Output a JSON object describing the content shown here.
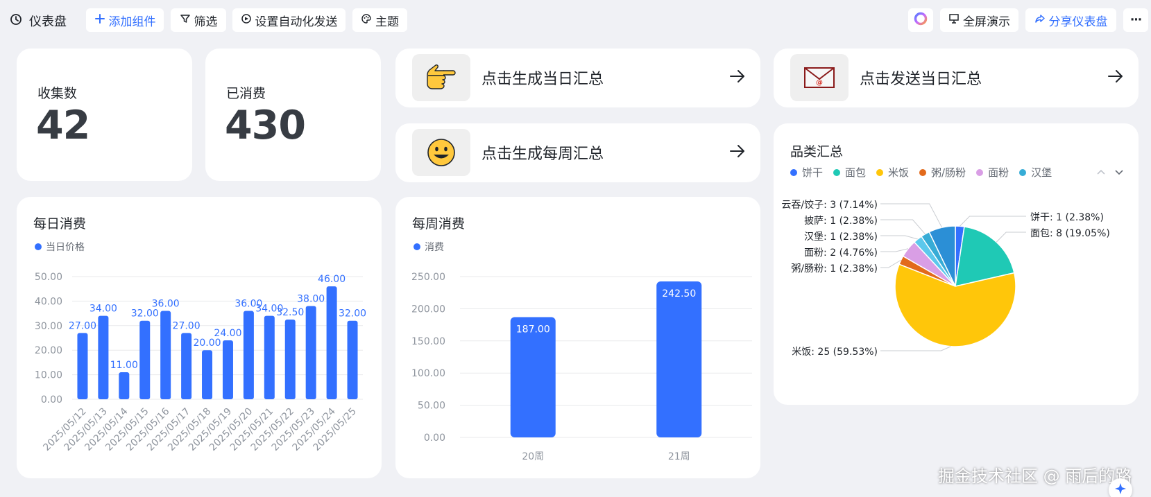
{
  "toolbar": {
    "title": "仪表盘",
    "add_widget": "添加组件",
    "filter": "筛选",
    "auto_send": "设置自动化发送",
    "theme": "主题",
    "fullscreen": "全屏演示",
    "share": "分享仪表盘",
    "more": "···"
  },
  "stats": {
    "collect_label": "收集数",
    "collect_value": "42",
    "consumed_label": "已消费",
    "consumed_value": "430"
  },
  "actions": {
    "daily_summary": "点击生成当日汇总",
    "weekly_summary": "点击生成每周汇总",
    "send_daily": "点击发送当日汇总"
  },
  "icons": {
    "daily_summary": "pointing-hand-icon",
    "weekly_summary": "smiley-face-icon",
    "send_daily": "email-envelope-icon"
  },
  "accent_color": "#3370ff",
  "watermark": "掘金技术社区 @ 雨后的路",
  "chart_data": [
    {
      "type": "bar",
      "title": "每日消费",
      "legend": [
        "当日价格"
      ],
      "categories": [
        "2025/05/12",
        "2025/05/13",
        "2025/05/14",
        "2025/05/15",
        "2025/05/16",
        "2025/05/17",
        "2025/05/18",
        "2025/05/19",
        "2025/05/20",
        "2025/05/21",
        "2025/05/22",
        "2025/05/23",
        "2025/05/24",
        "2025/05/25"
      ],
      "series": [
        {
          "name": "当日价格",
          "values": [
            27,
            34,
            11,
            32,
            36,
            27,
            20,
            24,
            36,
            34,
            32.5,
            38,
            46,
            32
          ],
          "color": "#3370ff"
        }
      ],
      "data_labels": [
        "27.00",
        "34.00",
        "11.00",
        "32.00",
        "36.00",
        "27.00",
        "20.00",
        "24.00",
        "36.00",
        "34.00",
        "32.50",
        "38.00",
        "46.00",
        "32.00"
      ],
      "y_ticks": [
        "0.00",
        "10.00",
        "20.00",
        "30.00",
        "40.00",
        "50.00"
      ],
      "ylim": [
        0,
        50
      ],
      "grid": true,
      "legend_position": "top-left"
    },
    {
      "type": "bar",
      "title": "每周消费",
      "legend": [
        "消费"
      ],
      "categories": [
        "20周",
        "21周"
      ],
      "series": [
        {
          "name": "消费",
          "values": [
            187,
            242.5
          ],
          "color": "#3370ff"
        }
      ],
      "data_labels": [
        "187.00",
        "242.50"
      ],
      "y_ticks": [
        "0.00",
        "50.00",
        "100.00",
        "150.00",
        "200.00",
        "250.00"
      ],
      "ylim": [
        0,
        250
      ],
      "grid": true,
      "legend_position": "top-left"
    },
    {
      "type": "pie",
      "title": "品类汇总",
      "legend": [
        "饼干",
        "面包",
        "米饭",
        "粥/肠粉",
        "面粉",
        "汉堡"
      ],
      "legend_colors": [
        "#3370ff",
        "#1fc9b5",
        "#ffc60a",
        "#e26a1b",
        "#d99ee5",
        "#37acd6"
      ],
      "slices": [
        {
          "label": "饼干",
          "value": 1,
          "percent": "2.38%",
          "color": "#3370ff",
          "text": "饼干: 1 (2.38%)"
        },
        {
          "label": "面包",
          "value": 8,
          "percent": "19.05%",
          "color": "#1fc9b5",
          "text": "面包: 8 (19.05%)"
        },
        {
          "label": "米饭",
          "value": 25,
          "percent": "59.53%",
          "color": "#ffc60a",
          "text": "米饭: 25 (59.53%)"
        },
        {
          "label": "粥/肠粉",
          "value": 1,
          "percent": "2.38%",
          "color": "#e26a1b",
          "text": "粥/肠粉: 1 (2.38%)"
        },
        {
          "label": "面粉",
          "value": 2,
          "percent": "4.76%",
          "color": "#d99ee5",
          "text": "面粉: 2 (4.76%)"
        },
        {
          "label": "汉堡",
          "value": 1,
          "percent": "2.38%",
          "color": "#5cc8ec",
          "text": "汉堡: 1 (2.38%)"
        },
        {
          "label": "披萨",
          "value": 1,
          "percent": "2.38%",
          "color": "#37acd6",
          "text": "披萨: 1 (2.38%)"
        },
        {
          "label": "云吞/饺子",
          "value": 3,
          "percent": "7.14%",
          "color": "#2b8fd6",
          "text": "云吞/饺子: 3 (7.14%)"
        }
      ],
      "legend_position": "top-left"
    }
  ]
}
